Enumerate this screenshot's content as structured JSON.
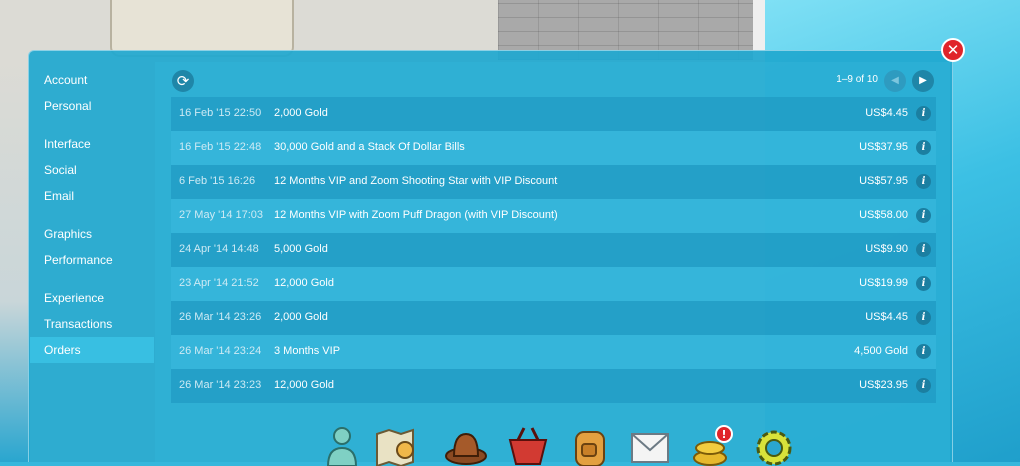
{
  "close_icon": "close-icon",
  "sidebar": {
    "items": [
      {
        "label": "Account"
      },
      {
        "label": "Personal"
      },
      {
        "label": "Interface"
      },
      {
        "label": "Social"
      },
      {
        "label": "Email"
      },
      {
        "label": "Graphics"
      },
      {
        "label": "Performance"
      },
      {
        "label": "Experience"
      },
      {
        "label": "Transactions"
      },
      {
        "label": "Orders",
        "active": true
      }
    ]
  },
  "pager": {
    "text": "1–9 of 10",
    "prev_icon": "chevron-left-icon",
    "next_icon": "chevron-right-icon"
  },
  "refresh_icon": "refresh-icon",
  "orders": [
    {
      "date": "16 Feb '15 22:50",
      "desc": "2,000 Gold",
      "price": "US$4.45"
    },
    {
      "date": "16 Feb '15 22:48",
      "desc": "30,000 Gold and a Stack Of Dollar Bills",
      "price": "US$37.95"
    },
    {
      "date": "6 Feb '15 16:26",
      "desc": "12 Months VIP and Zoom Shooting Star with VIP Discount",
      "price": "US$57.95"
    },
    {
      "date": "27 May '14 17:03",
      "desc": "12 Months VIP with Zoom Puff Dragon (with VIP Discount)",
      "price": "US$58.00"
    },
    {
      "date": "24 Apr '14 14:48",
      "desc": "5,000 Gold",
      "price": "US$9.90"
    },
    {
      "date": "23 Apr '14 21:52",
      "desc": "12,000 Gold",
      "price": "US$19.99"
    },
    {
      "date": "26 Mar '14 23:26",
      "desc": "2,000 Gold",
      "price": "US$4.45"
    },
    {
      "date": "26 Mar '14 23:24",
      "desc": "3 Months VIP",
      "price": "4,500 Gold"
    },
    {
      "date": "26 Mar '14 23:23",
      "desc": "12,000 Gold",
      "price": "US$23.95"
    }
  ],
  "info_glyph": "i",
  "toolbar_icons": [
    "avatar-icon",
    "map-icon",
    "hat-icon",
    "shop-basket-icon",
    "backpack-icon",
    "mail-icon",
    "gold-coins-alert-icon",
    "settings-gear-icon"
  ],
  "colors": {
    "panel": "#20a8d0",
    "active_item": "#38bfe2",
    "close": "#e0242a"
  }
}
